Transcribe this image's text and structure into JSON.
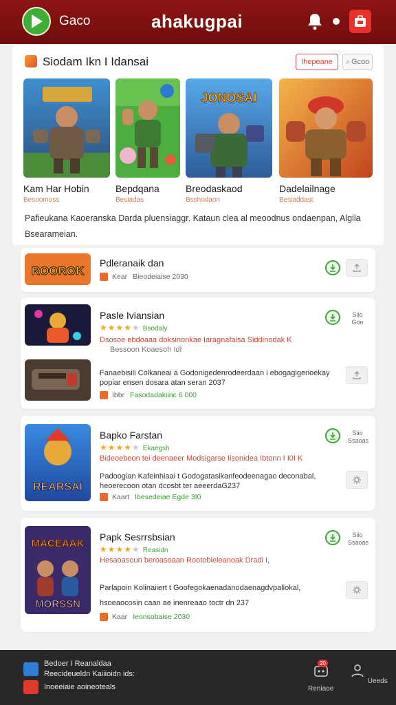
{
  "header": {
    "brand_small": "Gaco",
    "brand": "ahakugpai"
  },
  "featured": {
    "title": "Siodam Ikn I Idansai",
    "btn_primary": "Ihepeane",
    "btn_secondary": "Gcoo",
    "items": [
      {
        "name": "Kam Har Hobin",
        "sub": "Besoomoss"
      },
      {
        "name": "Bepdqana",
        "sub": "Besiadas"
      },
      {
        "name": "Breodaskaod",
        "sub": "Bsshodaon"
      },
      {
        "name": "Dadelailnage",
        "sub": "Besiaddast"
      }
    ],
    "art_texts": [
      "",
      "",
      "JONOSAI",
      ""
    ],
    "description": "Pafieukana Kaoeranska   Darda pluensiaggr.  Kataun clea al meoodnus  ondaenpan, Algila Bsearameian."
  },
  "cards": [
    {
      "title": "Pdleranaik dan",
      "meta": "Kear",
      "meta2": "Bieodeiaise 2030",
      "thumb_text": "ROOROK"
    },
    {
      "title": "Pasle Iviansian",
      "stars_label": "Bsodaly",
      "line_red": "Dsosoe ebdoaaa doksinonkae Iaragnafaisa Siddinodak K",
      "line_grey": "Bessoon Koaesoh IdI",
      "side_btn": "Siio Goo"
    },
    {
      "sub_line1": "Fanaebisili Colkaneai a Godonigedenrodeerdaan i ebogagigerioekay",
      "sub_line2": "popiar ensen dosara atan seran 2037",
      "meta": "Ibbr",
      "meta2": "Fasodadakiinc 6 000"
    },
    {
      "title": "Bapko Farstan",
      "stars_label": "Ekaegsh",
      "line_red": "Bideoebeon tei deenaeer Modsigarse Iisonidea Ibtonn I I0I K",
      "line1": "Padoogian Kafeinhiaai t Godogatasikanfeodeenagao deconabal,",
      "line2": "heoerecoon otan dcosbt ter aeeerdaG237",
      "meta": "Kaart",
      "meta2": "Ibesedeiae Egde 3I0",
      "side_btn": "Siio Ssaoas",
      "thumb_text": "REARSAI"
    },
    {
      "title": "Papk Sesrrsbsian",
      "stars_label": "Reasidn",
      "line_red": "Hesaoasoun beroasoaan Rootobieleanoak Dradi I,",
      "line1": "Parlapoin Kolinaiiert t Goofegokaenadanodaenagdvpaliokal,",
      "line2": "hsoeaocosin caan ae inenreaao toctr dn 237",
      "meta": "Kaar",
      "meta2": "Ieonsobaise 2030",
      "side_btn": "Siio Ssaoas",
      "thumb_text": "MORSSN",
      "thumb_text2": "MACEAAK"
    }
  ],
  "bottom_bar": {
    "row1": "Bedoer I Reanaldaa",
    "row2": "Reecideueldn Kaiiioidn ids:",
    "row3": "Inoeeiaie aoineoteals",
    "nav1_label": "Reniaoe",
    "nav1_badge": "20",
    "nav2_label": "Ueeds"
  },
  "icons": [
    "play-icon",
    "bell-icon",
    "dot-icon",
    "bag-icon",
    "download-icon",
    "share-icon",
    "settings-icon",
    "gamepad-icon",
    "profile-icon"
  ],
  "colors": {
    "header": "#8e1414",
    "accent_green": "#3fae34",
    "accent_red": "#e8322b",
    "star": "#f0a81c",
    "bottom_bar": "#2a2727"
  }
}
